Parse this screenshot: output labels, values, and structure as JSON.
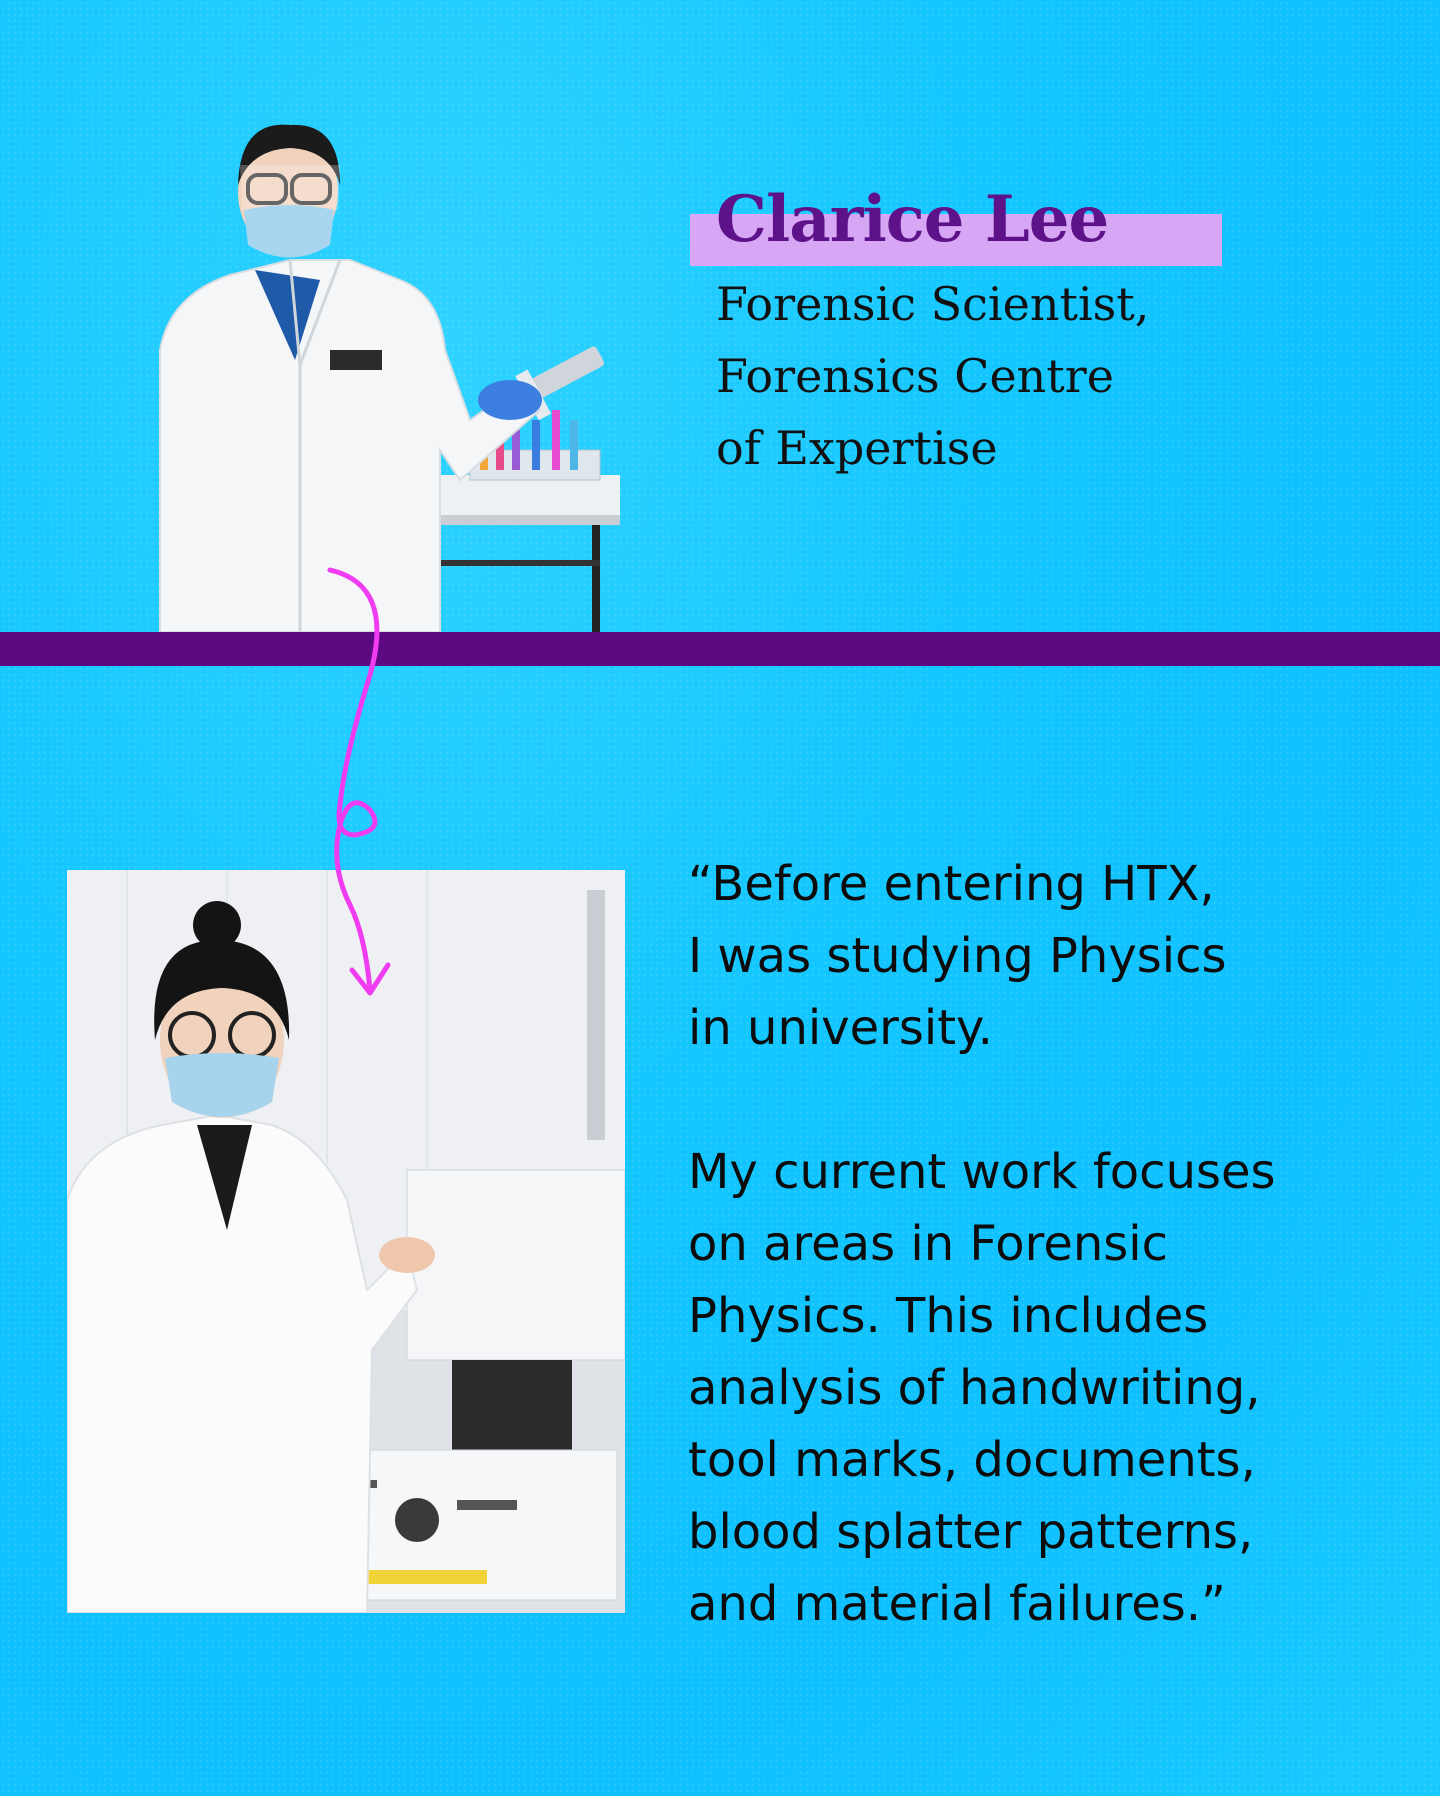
{
  "profile": {
    "name": "Clarice Lee",
    "role_lines": [
      "Forensic Scientist,",
      "Forensics Centre",
      "of Expertise"
    ]
  },
  "quote": {
    "paragraph1_lines": [
      "“Before entering HTX,",
      "I was studying Physics",
      "in university."
    ],
    "paragraph2_lines": [
      "My current work focuses",
      "on areas in Forensic",
      "Physics. This includes",
      "analysis of handwriting,",
      "tool marks, documents,",
      "blood splatter patterns,",
      "and material failures.”"
    ]
  },
  "colors": {
    "background": "#12c6ff",
    "accent_bar": "#5d0a82",
    "name_text": "#5e1289",
    "name_highlight": "#d7a6f5",
    "squiggle": "#f03cf0"
  },
  "images": {
    "top_photo": "scientist-with-pipette-photo",
    "bottom_photo": "scientist-with-microscope-photo"
  }
}
